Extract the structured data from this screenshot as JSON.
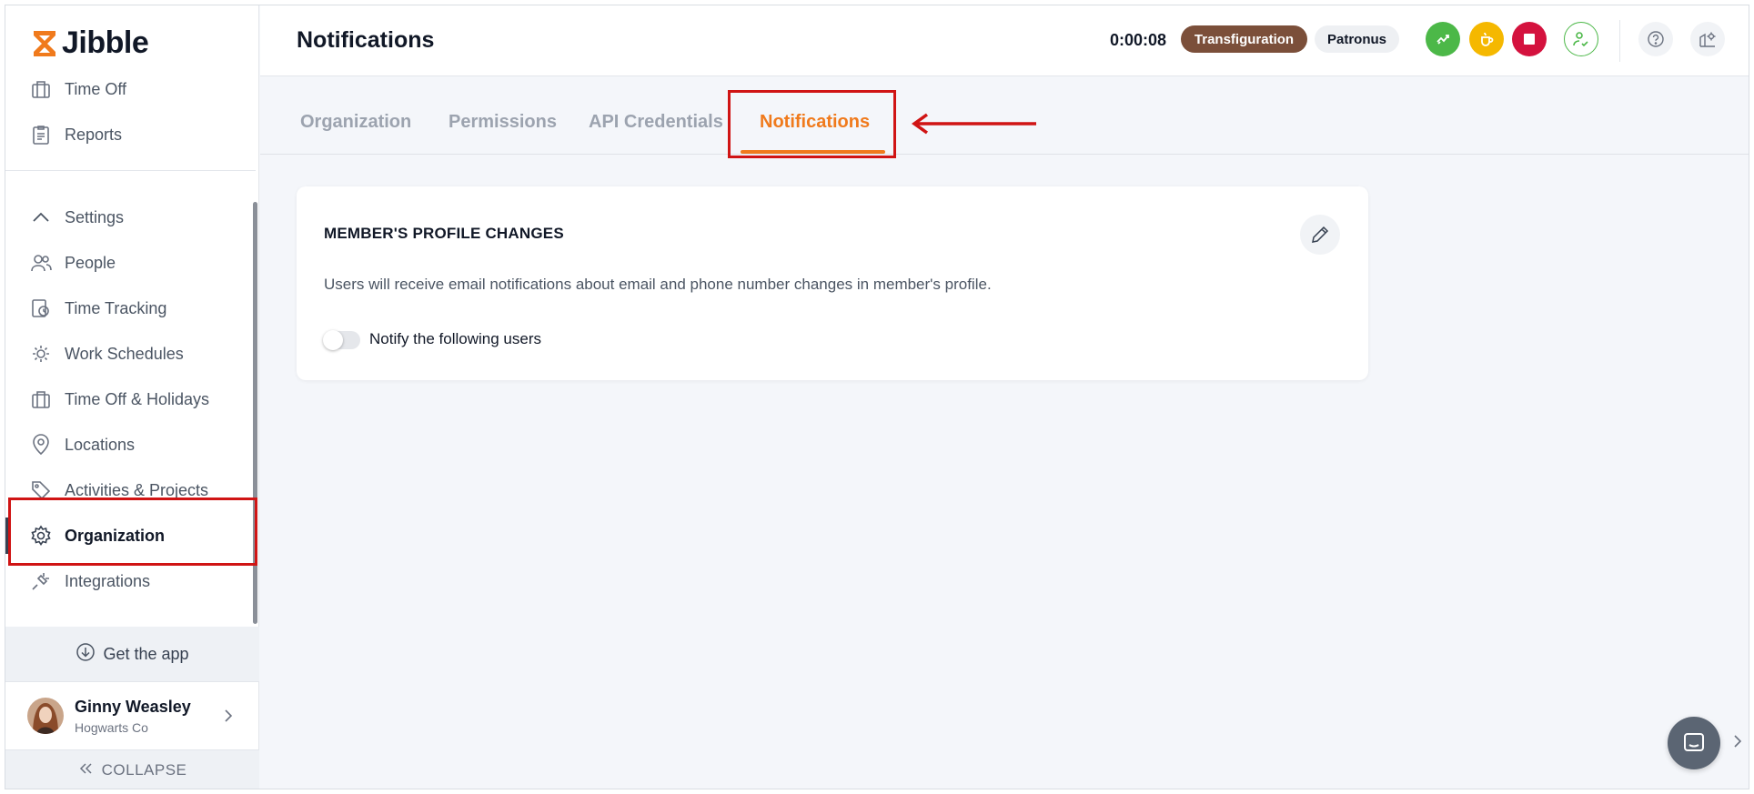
{
  "app": {
    "name": "Jibble"
  },
  "sidebar": {
    "items": [
      {
        "label": "Time Off",
        "icon": "suitcase-icon"
      },
      {
        "label": "Reports",
        "icon": "clipboard-icon"
      },
      {
        "label": "Settings",
        "icon": "chevron-up-icon"
      },
      {
        "label": "People",
        "icon": "people-icon"
      },
      {
        "label": "Time Tracking",
        "icon": "time-tracking-icon"
      },
      {
        "label": "Work Schedules",
        "icon": "schedule-icon"
      },
      {
        "label": "Time Off & Holidays",
        "icon": "suitcase-icon"
      },
      {
        "label": "Locations",
        "icon": "location-pin-icon"
      },
      {
        "label": "Activities & Projects",
        "icon": "tag-icon"
      },
      {
        "label": "Organization",
        "icon": "gear-icon"
      },
      {
        "label": "Integrations",
        "icon": "integrations-icon"
      }
    ],
    "active_item": "Organization",
    "get_app_label": "Get the app",
    "user": {
      "name": "Ginny Weasley",
      "org": "Hogwarts Co"
    },
    "collapse_label": "COLLAPSE"
  },
  "header": {
    "title": "Notifications",
    "timer": "0:00:08",
    "activity_chip": "Transfiguration",
    "project_chip": "Patronus"
  },
  "tabs": {
    "items": [
      "Organization",
      "Permissions",
      "API Credentials",
      "Notifications"
    ],
    "active": "Notifications"
  },
  "card": {
    "title": "MEMBER'S PROFILE CHANGES",
    "description": "Users will receive email notifications about email and phone number changes in member's profile.",
    "toggle_label": "Notify the following users",
    "toggle_on": false
  },
  "colors": {
    "accent": "#f07a1c",
    "highlight": "#d01414",
    "chip_dark": "#7b4f3a",
    "btn_green": "#4cb848",
    "btn_yellow": "#f5b800",
    "btn_red": "#d4123e"
  }
}
